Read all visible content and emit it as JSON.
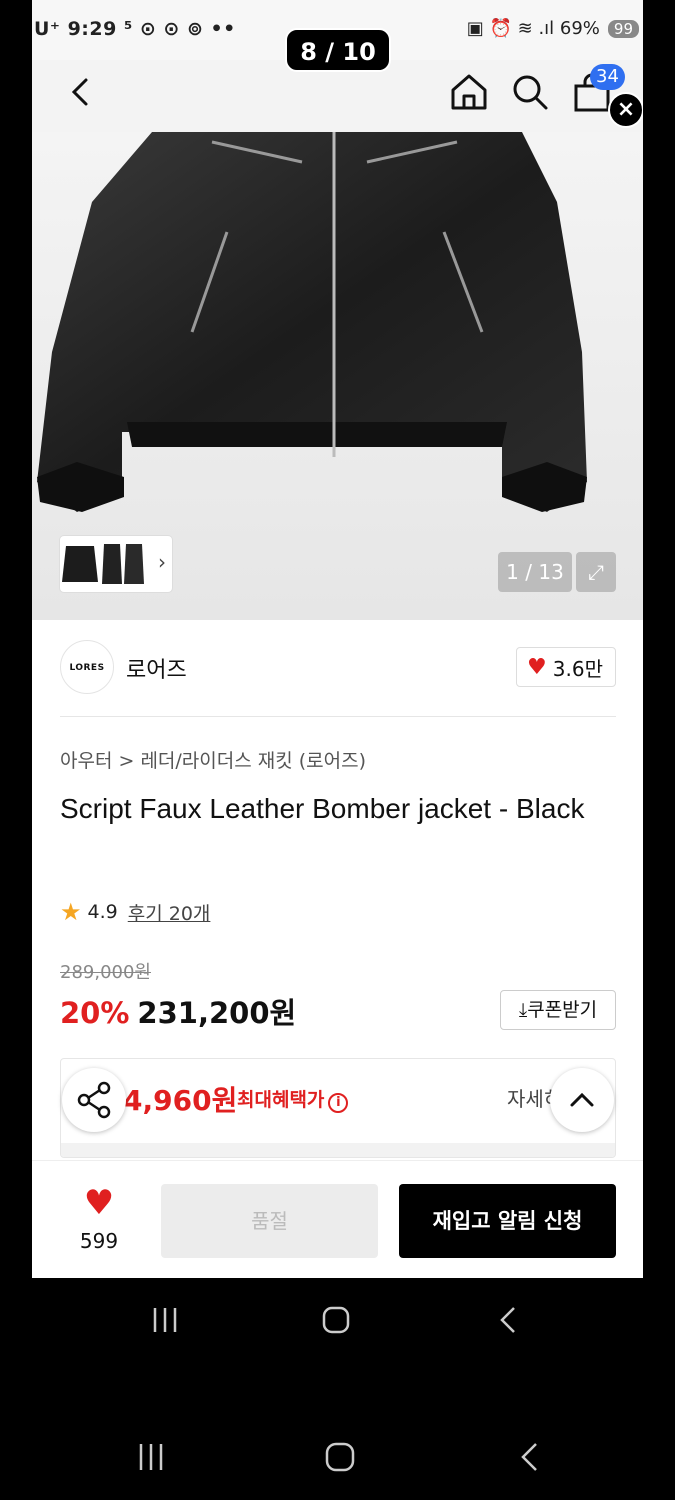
{
  "status_bar": {
    "left_text": "U⁺ 9:29 ⁵ ⊙ ⊙ ⊚ ••",
    "right_text": "▣ ⏰ ≋ .ıl 69%",
    "battery": "99"
  },
  "header": {
    "pager": "8 / 10",
    "cart_count": "34",
    "close_symbol": "×"
  },
  "gallery": {
    "counter": "1 / 13",
    "thumb_chevron": "›"
  },
  "brand": {
    "logo_text": "LORES",
    "name": "로어즈",
    "like_count": "3.6만"
  },
  "breadcrumb": "아우터 > 레더/라이더스 재킷 (로어즈)",
  "product": {
    "title": "Script Faux Leather Bomber jacket - Black"
  },
  "rating": {
    "score": "4.9",
    "reviews": "후기 20개"
  },
  "price": {
    "original": "289,000원",
    "discount": "20%",
    "sale": "231,200원",
    "coupon_label": "⤓쿠폰받기"
  },
  "benefit": {
    "amount": "4,960원",
    "label": "최대혜택가",
    "info": "i",
    "detail": "자세히"
  },
  "bottom": {
    "wish_count": "599",
    "soldout_label": "품절",
    "restock_label": "재입고 알림 신청"
  },
  "colors": {
    "accent_red": "#e02020",
    "badge_blue": "#2f6ff0"
  }
}
